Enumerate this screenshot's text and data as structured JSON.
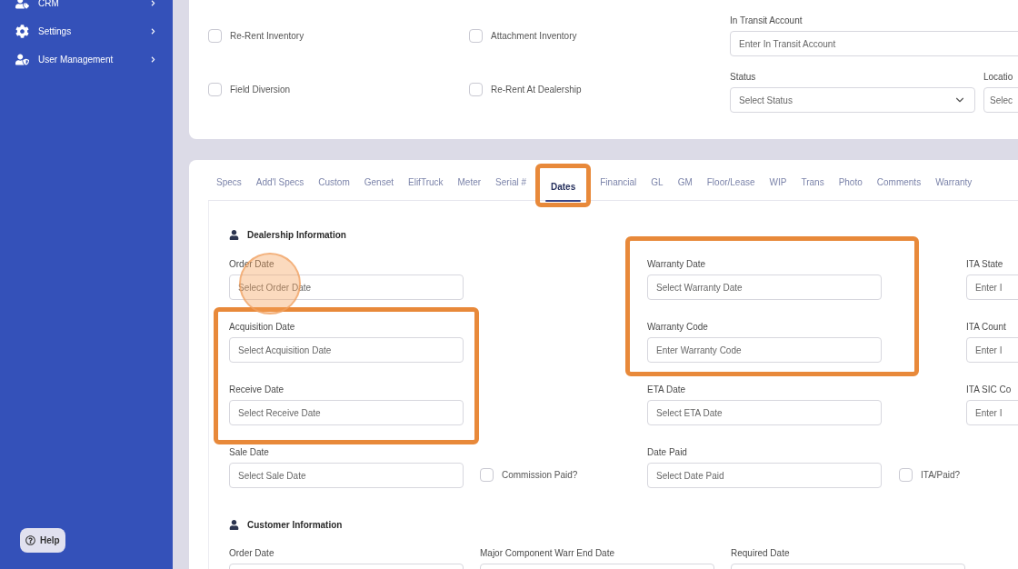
{
  "sidebar": {
    "items": [
      {
        "label": "CRM"
      },
      {
        "label": "Settings"
      },
      {
        "label": "User Management"
      }
    ],
    "help": "Help"
  },
  "top_form": {
    "checkboxes": [
      {
        "label": "Re-Rent Inventory",
        "checked": false
      },
      {
        "label": "Attachment Inventory",
        "checked": false
      },
      {
        "label": "Field Diversion",
        "checked": false
      },
      {
        "label": "Re-Rent At Dealership",
        "checked": false
      }
    ],
    "in_transit_account": {
      "label": "In Transit Account",
      "placeholder": "Enter In Transit Account"
    },
    "status": {
      "label": "Status",
      "placeholder": "Select Status"
    },
    "location": {
      "label": "Locatio",
      "placeholder": "Selec"
    }
  },
  "tabs": [
    {
      "label": "Specs",
      "selected": false
    },
    {
      "label": "Add'l Specs",
      "selected": false
    },
    {
      "label": "Custom",
      "selected": false
    },
    {
      "label": "Genset",
      "selected": false
    },
    {
      "label": "ElifTruck",
      "selected": false
    },
    {
      "label": "Meter",
      "selected": false
    },
    {
      "label": "Serial #",
      "selected": false
    },
    {
      "label": "Dates",
      "selected": true,
      "highlighted": true
    },
    {
      "label": "Financial",
      "selected": false
    },
    {
      "label": "GL",
      "selected": false
    },
    {
      "label": "GM",
      "selected": false
    },
    {
      "label": "Floor/Lease",
      "selected": false
    },
    {
      "label": "WIP",
      "selected": false
    },
    {
      "label": "Trans",
      "selected": false
    },
    {
      "label": "Photo",
      "selected": false
    },
    {
      "label": "Comments",
      "selected": false
    },
    {
      "label": "Warranty",
      "selected": false
    }
  ],
  "dealership": {
    "title": "Dealership Information",
    "rows": [
      {
        "left": {
          "label": "Order Date",
          "placeholder": "Select Order Date"
        },
        "right": {
          "label": "Warranty Date",
          "placeholder": "Select Warranty Date"
        },
        "far": {
          "label": "ITA State",
          "placeholder": "Enter I"
        }
      },
      {
        "left": {
          "label": "Acquisition Date",
          "placeholder": "Select Acquisition Date"
        },
        "right": {
          "label": "Warranty Code",
          "placeholder": "Enter Warranty Code"
        },
        "far": {
          "label": "ITA Count",
          "placeholder": "Enter I"
        }
      },
      {
        "left": {
          "label": "Receive Date",
          "placeholder": "Select Receive Date"
        },
        "right": {
          "label": "ETA Date",
          "placeholder": "Select ETA Date"
        },
        "far": {
          "label": "ITA SIC Co",
          "placeholder": "Enter I"
        }
      },
      {
        "left": {
          "label": "Sale Date",
          "placeholder": "Select Sale Date"
        },
        "checkbox": {
          "label": "Commission Paid?",
          "checked": false
        },
        "right": {
          "label": "Date Paid",
          "placeholder": "Select Date Paid"
        },
        "right_checkbox": {
          "label": "ITA/Paid?",
          "checked": false
        }
      }
    ]
  },
  "customer": {
    "title": "Customer Information",
    "fields": [
      {
        "label": "Order Date"
      },
      {
        "label": "Major Component Warr End Date"
      },
      {
        "label": "Required Date"
      }
    ]
  }
}
